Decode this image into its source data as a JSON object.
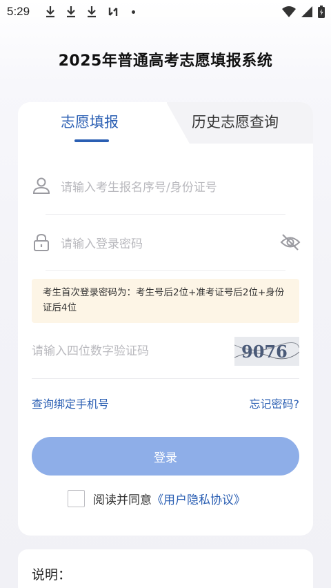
{
  "status_bar": {
    "time": "5:29",
    "icons": [
      "download-icon",
      "download-icon",
      "download-icon",
      "sync-icon",
      "dot-icon",
      "wifi-icon",
      "signal-icon",
      "battery-icon"
    ]
  },
  "app_title": "2025年普通高考志愿填报系统",
  "tabs": [
    {
      "label": "志愿填报",
      "active": true
    },
    {
      "label": "历史志愿查询",
      "active": false
    }
  ],
  "form": {
    "id_placeholder": "请输入考生报名序号/身份证号",
    "password_placeholder": "请输入登录密码",
    "notice": "考生首次登录密码为：考生号后2位+准考证号后2位+身份证后4位",
    "captcha_placeholder": "请输入四位数字验证码",
    "captcha_text": "9076"
  },
  "links": {
    "bind_phone": "查询绑定手机号",
    "forgot_password": "忘记密码?"
  },
  "login_button": "登录",
  "agreement": {
    "prefix": "阅读并同意",
    "link": "《用户隐私协议》"
  },
  "description_title": "说明：",
  "colors": {
    "primary": "#2b5fb3",
    "button_disabled": "#8eaee8",
    "notice_bg": "#fdf5e6"
  }
}
